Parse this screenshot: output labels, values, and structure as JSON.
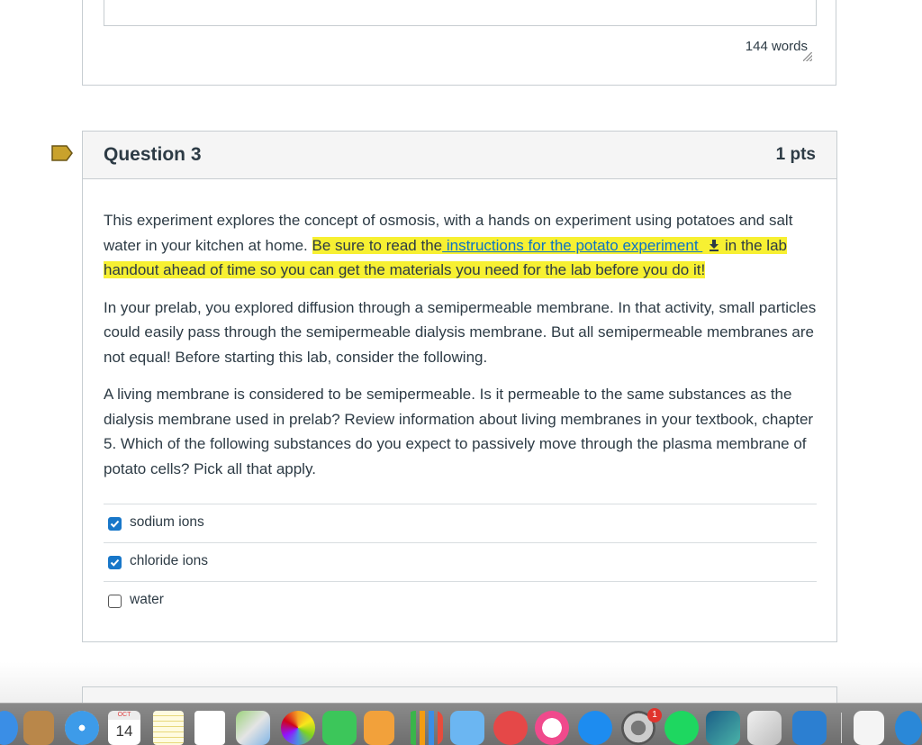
{
  "previous_question": {
    "word_count": "144 words"
  },
  "question": {
    "title": "Question 3",
    "points": "1 pts",
    "paragraph1_plain": "This experiment explores the concept of osmosis, with a hands on experiment using potatoes and salt water in your kitchen at home. ",
    "paragraph1_hl_start": "Be sure to read the",
    "link_text": " instructions for the potato experiment ",
    "paragraph1_hl_end": " in the lab handout ahead of time so you can get the materials you need for the lab before you do it!",
    "paragraph2": "In your prelab, you explored diffusion through a semipermeable membrane.  In that activity, small particles could easily pass through the semipermeable dialysis membrane. But all semipermeable membranes are not equal!  Before starting this lab, consider the following.",
    "paragraph3": "A living membrane is considered to be semipermeable. Is it permeable to the same substances as the dialysis membrane used in prelab?  Review information about living membranes in your textbook, chapter 5. Which of the following substances do you expect to passively move through the plasma membrane of potato cells? Pick all that apply.",
    "answers": [
      {
        "label": "sodium ions",
        "checked": true
      },
      {
        "label": "chloride ions",
        "checked": true
      },
      {
        "label": "water",
        "checked": false
      }
    ]
  },
  "dock": {
    "calendar_month": "OCT",
    "calendar_day": "14",
    "notification_badge": "1"
  },
  "colors": {
    "highlight": "#f7f032",
    "link": "#0b73c6",
    "checkbox": "#1877c9",
    "flag": "#c9a22c"
  }
}
